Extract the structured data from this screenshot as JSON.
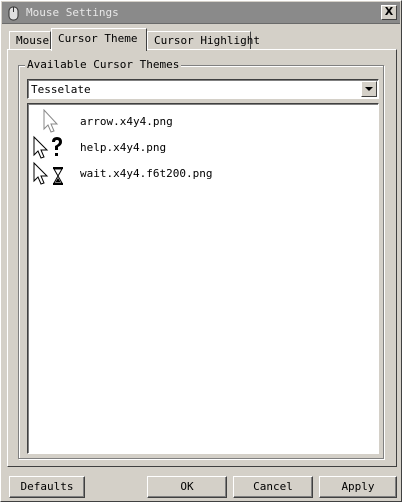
{
  "window": {
    "title": "Mouse Settings",
    "close_glyph": "X"
  },
  "tabs": [
    {
      "label": "Mouse"
    },
    {
      "label": "Cursor Theme"
    },
    {
      "label": "Cursor Highlight"
    }
  ],
  "active_tab": "Cursor Theme",
  "themes_group": {
    "label": "Available Cursor Themes",
    "selected_theme": "Tesselate"
  },
  "cursor_files": [
    {
      "name": "arrow.x4y4.png",
      "icon": "arrow-cursor-icon"
    },
    {
      "name": "help.x4y4.png",
      "icon": "help-cursor-icon"
    },
    {
      "name": "wait.x4y4.f6t200.png",
      "icon": "wait-cursor-icon"
    }
  ],
  "buttons": {
    "defaults": "Defaults",
    "ok": "OK",
    "cancel": "Cancel",
    "apply": "Apply"
  }
}
